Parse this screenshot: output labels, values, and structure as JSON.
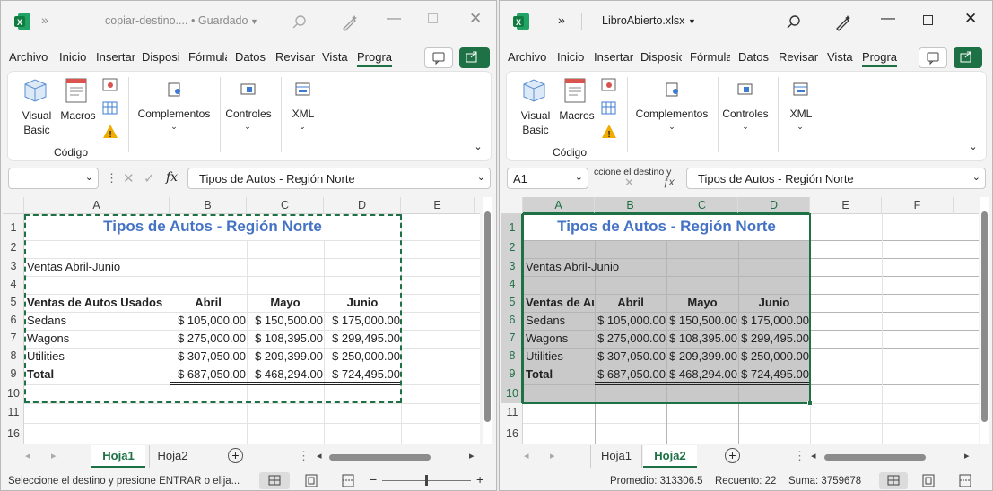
{
  "left_window": {
    "title": "copiar-destino....",
    "saved": "• Guardado",
    "chevron": "»",
    "tabs": [
      "Archivo",
      "Inicio",
      "Insertar",
      "Disposi",
      "Fórmula",
      "Datos",
      "Revisar",
      "Vista",
      "Progra"
    ],
    "active_tab": "Progra",
    "ribbon": {
      "visual_basic": "Visual\nBasic",
      "macros": "Macros",
      "group_code": "Código",
      "complementos": "Complementos",
      "controles": "Controles",
      "xml": "XML"
    },
    "name_box": "",
    "formula": "Tipos de Autos - Región Norte",
    "fx": "fx",
    "columns": [
      "A",
      "B",
      "C",
      "D",
      "E"
    ],
    "rows": [
      "1",
      "2",
      "3",
      "4",
      "5",
      "6",
      "7",
      "8",
      "9",
      "10",
      "11",
      "16"
    ],
    "cells": {
      "a1": "Tipos de Autos - Región Norte",
      "a3": "Ventas Abril-Junio",
      "a5": "Ventas de Autos Usados",
      "b5": "Abril",
      "c5": "Mayo",
      "d5": "Junio",
      "a6": "Sedans",
      "b6": "$ 105,000.00",
      "c6": "$ 150,500.00",
      "d6": "$ 175,000.00",
      "a7": "Wagons",
      "b7": "$ 275,000.00",
      "c7": "$ 108,395.00",
      "d7": "$ 299,495.00",
      "a8": "Utilities",
      "b8": "$ 307,050.00",
      "c8": "$ 209,399.00",
      "d8": "$ 250,000.00",
      "a9": "Total",
      "b9": "$ 687,050.00",
      "c9": "$ 468,294.00",
      "d9": "$ 724,495.00"
    },
    "sheets": [
      "Hoja1",
      "Hoja2"
    ],
    "active_sheet": "Hoja1",
    "status": "Seleccione el destino y presione ENTRAR o elija..."
  },
  "right_window": {
    "title": "LibroAbierto.xlsx",
    "chevron": "»",
    "tabs": [
      "Archivo",
      "Inicio",
      "Insertar",
      "Disposic",
      "Fórmula",
      "Datos",
      "Revisar",
      "Vista",
      "Progra"
    ],
    "active_tab": "Progra",
    "ribbon": {
      "visual_basic": "Visual\nBasic",
      "macros": "Macros",
      "group_code": "Código",
      "complementos": "Complementos",
      "controles": "Controles",
      "xml": "XML"
    },
    "name_box": "A1",
    "tooltip_fragment": "ccione el destino y",
    "formula": "Tipos de Autos - Región Norte",
    "columns": [
      "A",
      "B",
      "C",
      "D",
      "E",
      "F"
    ],
    "rows": [
      "1",
      "2",
      "3",
      "4",
      "5",
      "6",
      "7",
      "8",
      "9",
      "10",
      "11",
      "16"
    ],
    "cells": {
      "a1": "Tipos de Autos - Región Norte",
      "a3": "Ventas Abril-Junio",
      "a5": "Ventas de Autos Usados",
      "b5": "Abril",
      "c5": "Mayo",
      "d5": "Junio",
      "a6": "Sedans",
      "b6": "$ 105,000.00",
      "c6": "$ 150,500.00",
      "d6": "$ 175,000.00",
      "a7": "Wagons",
      "b7": "$ 275,000.00",
      "c7": "$ 108,395.00",
      "d7": "$ 299,495.00",
      "a8": "Utilities",
      "b8": "$ 307,050.00",
      "c8": "$ 209,399.00",
      "d8": "$ 250,000.00",
      "a9": "Total",
      "b9": "$ 687,050.00",
      "c9": "$ 468,294.00",
      "d9": "$ 724,495.00"
    },
    "sheets": [
      "Hoja1",
      "Hoja2"
    ],
    "active_sheet": "Hoja2",
    "status_promedio": "Promedio: 313306.5",
    "status_recuento": "Recuento: 22",
    "status_suma": "Suma: 3759678"
  },
  "colors": {
    "accent": "#1e7145",
    "title_blue": "#4472c4",
    "selection": "#c9c9c9"
  }
}
